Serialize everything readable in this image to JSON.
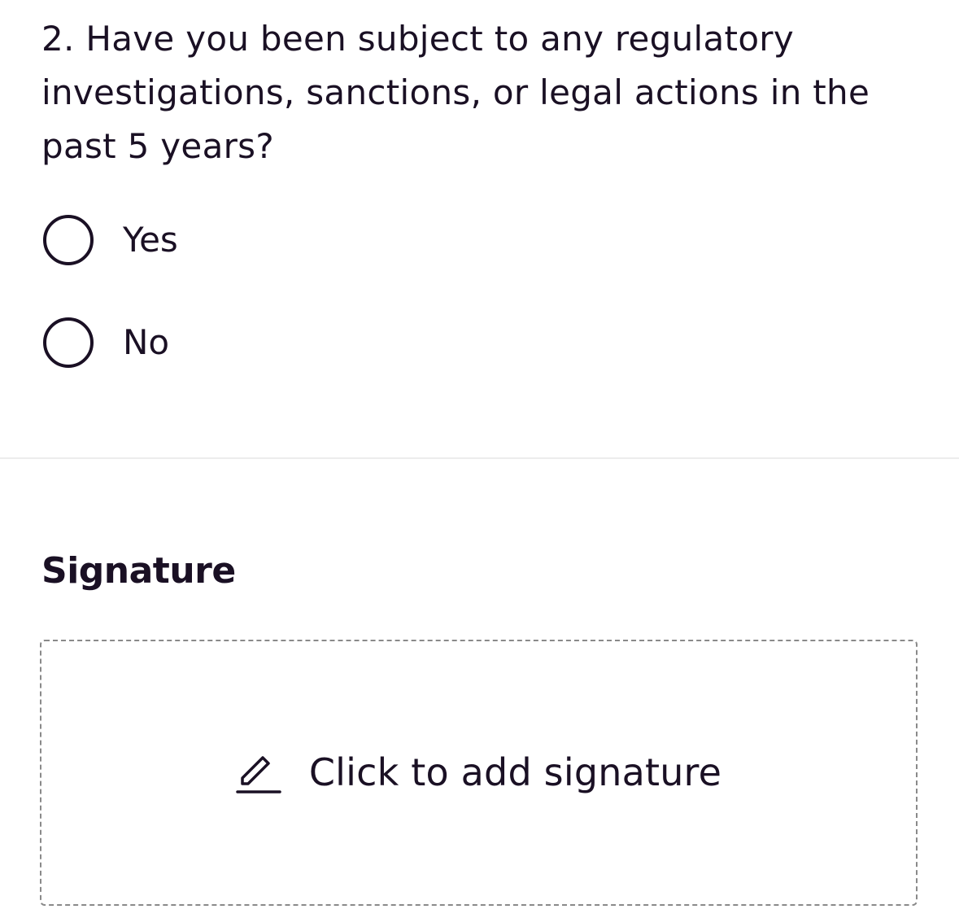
{
  "question": {
    "text": "2. Have you been subject to any regulatory investigations, sanctions, or legal actions in the past 5 years?",
    "options": [
      {
        "label": "Yes",
        "selected": false
      },
      {
        "label": "No",
        "selected": false
      }
    ]
  },
  "signature": {
    "heading": "Signature",
    "cta_label": "Click to add signature",
    "icon": "pen-icon"
  },
  "colors": {
    "text": "#1a1024",
    "divider": "#ececec",
    "dashed_border": "#8a8a8a",
    "background": "#ffffff"
  }
}
